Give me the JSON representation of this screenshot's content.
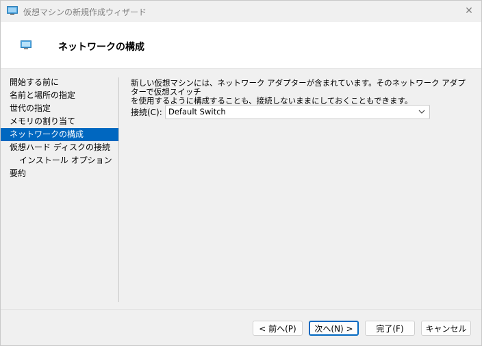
{
  "window": {
    "title": "仮想マシンの新規作成ウィザード",
    "close_glyph": "✕"
  },
  "header": {
    "title": "ネットワークの構成"
  },
  "sidebar": {
    "items": [
      {
        "label": "開始する前に"
      },
      {
        "label": "名前と場所の指定"
      },
      {
        "label": "世代の指定"
      },
      {
        "label": "メモリの割り当て"
      },
      {
        "label": "ネットワークの構成",
        "active": true
      },
      {
        "label": "仮想ハード ディスクの接続"
      },
      {
        "label": "インストール オプション",
        "sub": true
      },
      {
        "label": "要約"
      }
    ]
  },
  "content": {
    "description_line1": "新しい仮想マシンには、ネットワーク アダプターが含まれています。そのネットワーク アダプターで仮想スイッチ",
    "description_line2": "を使用するように構成することも、接続しないままにしておくこともできます。",
    "connection_label": "接続(C):",
    "connection_value": "Default Switch"
  },
  "footer": {
    "back_label": "< 前へ(P)",
    "next_label": "次へ(N) >",
    "finish_label": "完了(F)",
    "cancel_label": "キャンセル"
  },
  "colors": {
    "accent": "#0067c0",
    "window_bg": "#f0f0f0",
    "header_bg": "#ffffff"
  },
  "icons": {
    "app_icon": "monitor-icon",
    "chevron": "chevron-down-icon",
    "close": "close-icon"
  }
}
